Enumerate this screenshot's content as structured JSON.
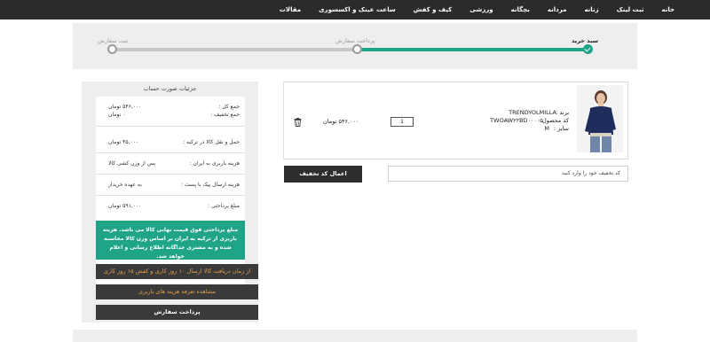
{
  "nav": {
    "items": [
      "خانه",
      "ثبت لینک",
      "زنانه",
      "مردانه",
      "بچگانه",
      "ورزشی",
      "کیف و کفش",
      "ساعت عینک و اکسسوری",
      "مقالات"
    ]
  },
  "progress": {
    "steps": [
      {
        "label": "سبد خرید",
        "state": "done"
      },
      {
        "label": "پرداخت سفارش",
        "state": "pending"
      },
      {
        "label": "ثبت سفارش",
        "state": "pending"
      }
    ],
    "accent": "#1fa487"
  },
  "invoice": {
    "title": "جزئیات صورت حساب",
    "total_label": "جمع کل :",
    "total_value": "۵۴۶,۰۰۰ تومان",
    "discount_label": "جمع تخفیف :",
    "discount_value": "۰ تومان",
    "shipping_label": "حمل و نقل کالا در ترکیه :",
    "shipping_value": "۴۵,۰۰۰ تومان",
    "freight_label": "هزینه باربری به ایران :",
    "freight_value": "پس از وزن کشی کالا",
    "post_label": "هزینه ارسال پیک یا پست :",
    "post_value": "به عهده خریدار",
    "payable_label": "مبلغ پرداختی :",
    "payable_value": "۵۹۱,۰۰۰ تومان",
    "notice": "مبلغ پرداختی فوق قیمت نهایی کالا می باشد. هزینه باربری از ترکیه به ایران بر اساس وزن کالا محاسبه شده و به مشتری جداگانه اطلاع رسانی و اعلام خواهد شد.",
    "delivery_button": "از زمان دریافت کالا ارسال ۱۰ روز کاری و کفش ۱۵ روز کاری",
    "freight_rates_button": "مشاهده تعرفه هزینه های باربری",
    "pay_button": "پرداخت سفارش"
  },
  "cart": {
    "brand_label": "برند :",
    "brand_value": "TRENDYOLMILLA",
    "code_label": "کد محصول :",
    "code_value": "TWOAW۲۲BD۰۰۰۰۵",
    "size_label": "سایز :",
    "size_value": "M",
    "quantity": "1",
    "price": "۵۴۶,۰۰۰ تومان",
    "trash_icon": "trash-icon"
  },
  "discount": {
    "apply_button": "اعمال کد تخفیف",
    "placeholder": "کد تخفیف خود را وارد کنید"
  }
}
